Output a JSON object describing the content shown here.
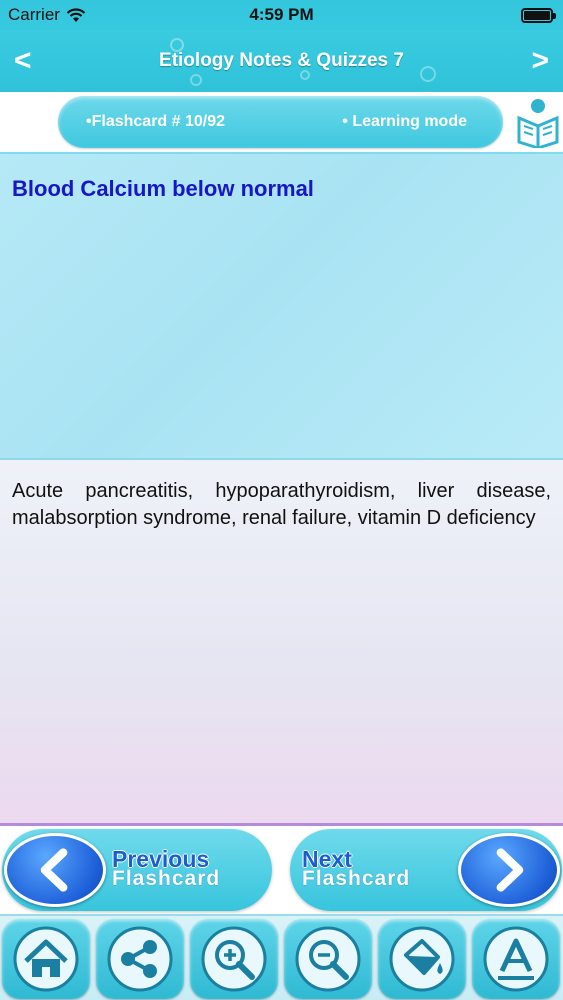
{
  "status_bar": {
    "carrier": "Carrier",
    "time": "4:59 PM"
  },
  "nav": {
    "title": "Etiology Notes & Quizzes 7",
    "back_icon": "<",
    "forward_icon": ">"
  },
  "info": {
    "flashcard_label": "•Flashcard #  10/92",
    "mode_label": "• Learning mode"
  },
  "card": {
    "question": "Blood Calcium below normal",
    "answer": "Acute pancreatitis, hypoparathyroidism, liver disease, malabsorption syndrome, renal failure, vitamin D deficiency"
  },
  "flash_nav": {
    "prev_line1": "Previous",
    "prev_line2": "Flashcard",
    "next_line1": "Next",
    "next_line2": "Flashcard"
  },
  "toolbar_icons": [
    "home-icon",
    "share-icon",
    "zoom-in-icon",
    "zoom-out-icon",
    "paint-bucket-icon",
    "font-icon"
  ],
  "colors": {
    "accent": "#36c9de",
    "question_text": "#1717c8",
    "arrow_circle": "#1d5fd8"
  }
}
